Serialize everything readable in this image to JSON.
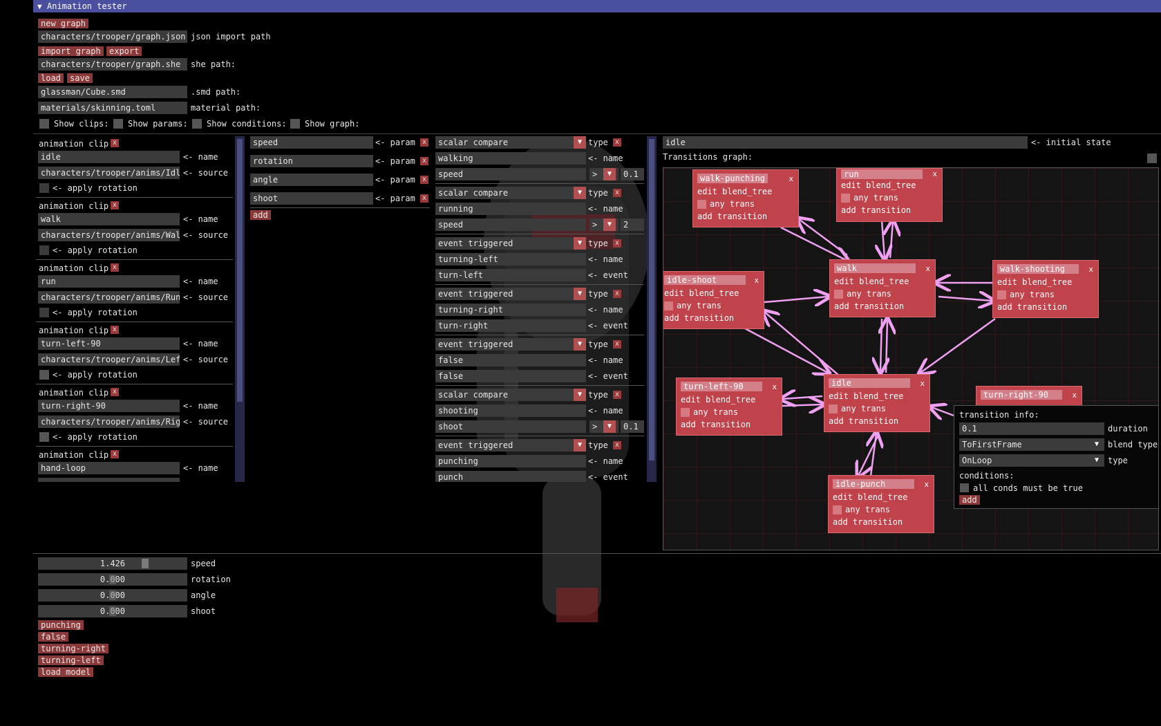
{
  "window": {
    "title": "Animation tester"
  },
  "top": {
    "new_graph": "new graph",
    "json_path": "characters/trooper/graph.json",
    "json_path_label": "json import path",
    "import_graph": "import graph",
    "export": "export",
    "she_path": "characters/trooper/graph.she",
    "she_path_label": "she path:",
    "load": "load",
    "save": "save",
    "smd_path": "glassman/Cube.smd",
    "smd_path_label": ".smd path:",
    "material_path": "materials/skinning.toml",
    "material_path_label": "material path:",
    "show_clips": "Show clips:",
    "show_params": "Show params:",
    "show_conditions": "Show conditions:",
    "show_graph": "Show graph:"
  },
  "clips": {
    "header": "animation clip",
    "name_label": "<- name",
    "source_label": "<- source",
    "rotation_label": "<- apply rotation",
    "items": [
      {
        "name": "idle",
        "source": "characters/trooper/anims/Idle"
      },
      {
        "name": "walk",
        "source": "characters/trooper/anims/Walk"
      },
      {
        "name": "run",
        "source": "characters/trooper/anims/Run"
      },
      {
        "name": "turn-left-90",
        "source": "characters/trooper/anims/Left"
      },
      {
        "name": "turn-right-90",
        "source": "characters/trooper/anims/Right"
      },
      {
        "name": "hand-loop",
        "source": ""
      }
    ]
  },
  "params": {
    "param_label": "<- param",
    "items": [
      "speed",
      "rotation",
      "angle",
      "shoot"
    ],
    "add": "add"
  },
  "conditions": {
    "type_label": "type",
    "name_label": "<- name",
    "event_label": "<- event",
    "items": [
      {
        "type": "scalar compare",
        "name": "walking",
        "param": "speed",
        "op": ">",
        "value": "0.1"
      },
      {
        "type": "scalar compare",
        "name": "running",
        "param": "speed",
        "op": ">",
        "value": "2"
      },
      {
        "type": "event triggered",
        "name": "turning-left",
        "event": "turn-left"
      },
      {
        "type": "event triggered",
        "name": "turning-right",
        "event": "turn-right"
      },
      {
        "type": "event triggered",
        "name": "false",
        "event": "false"
      },
      {
        "type": "scalar compare",
        "name": "shooting",
        "param": "shoot",
        "op": ">",
        "value": "0.1"
      },
      {
        "type": "event triggered",
        "name": "punching",
        "event": "punch"
      }
    ]
  },
  "graph": {
    "initial_state": "idle",
    "initial_state_label": "<- initial state",
    "transitions_label": "Transitions graph:",
    "node_edit": "edit blend_tree",
    "node_any": "any trans",
    "node_add": "add transition",
    "node_close": "x",
    "nodes": [
      "walk-punching",
      "run",
      "walk",
      "walk-shooting",
      "idle-shoot",
      "turn-left-90",
      "idle",
      "turn-right-90",
      "idle-punch"
    ],
    "edge_color": "#f0a0f0",
    "node_color": "#c0424a"
  },
  "transition_info": {
    "title": "transition info:",
    "duration": "0.1",
    "duration_label": "duration",
    "blend_type": "ToFirstFrame",
    "blend_type_label": "blend type",
    "type": "OnLoop",
    "type_label": "type",
    "conditions_label": "conditions:",
    "all_conds": "all conds must be true",
    "add": "add"
  },
  "sliders": [
    {
      "label": "speed",
      "value": "1.426"
    },
    {
      "label": "rotation",
      "value": "0.000"
    },
    {
      "label": "angle",
      "value": "0.000"
    },
    {
      "label": "shoot",
      "value": "0.000"
    }
  ],
  "events": [
    "punching",
    "false",
    "turning-right",
    "turning-left"
  ],
  "load_model": "load model"
}
